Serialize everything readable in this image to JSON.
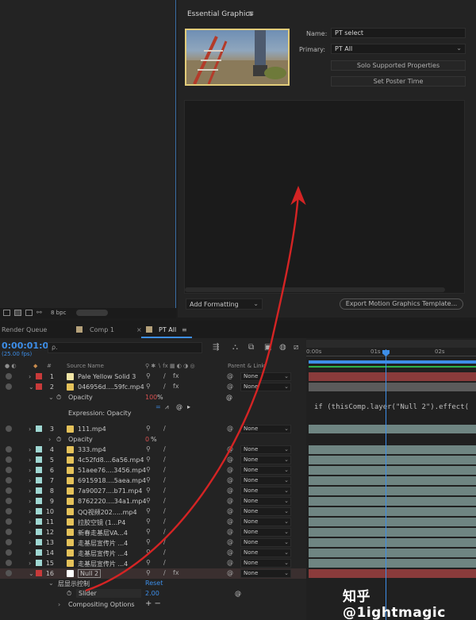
{
  "comp_panel": {
    "footer": {
      "bit_depth": "8 bpc"
    }
  },
  "eg": {
    "title": "Essential Graphics",
    "name_label": "Name:",
    "name_value": "PT select",
    "primary_label": "Primary:",
    "primary_value": "PT All",
    "solo_button": "Solo Supported Properties",
    "poster_button": "Set Poster Time",
    "add_formatting": "Add Formatting",
    "export_button": "Export Motion Graphics Template..."
  },
  "timeline": {
    "tabs": [
      {
        "label": "Render Queue"
      },
      {
        "label": "Comp 1"
      },
      {
        "label": "PT All"
      }
    ],
    "timecode": "0:00:01:04",
    "fps": "(25.00 fps)",
    "search_placeholder": "ρ.",
    "headers": {
      "hash": "#",
      "source_name": "Source Name",
      "parent": "Parent & Link"
    },
    "ruler": [
      "0:00s",
      "01s",
      "02s"
    ],
    "layers": [
      {
        "num": "1",
        "name": "Pale Yellow Solid 3",
        "parent": "None",
        "color": "#c83a3a",
        "icon": "#f2e6a6"
      },
      {
        "num": "2",
        "name": "046956d....59fc.mp4",
        "parent": "None",
        "color": "#c83a3a",
        "icon": "#e5c25a"
      },
      {
        "num": "3",
        "name": "111.mp4",
        "parent": "None",
        "color": "#9fd7d2",
        "icon": "#e5c25a"
      },
      {
        "num": "4",
        "name": "333.mp4",
        "parent": "None",
        "color": "#9fd7d2",
        "icon": "#e5c25a"
      },
      {
        "num": "5",
        "name": "4c52fd8....6a56.mp4",
        "parent": "None",
        "color": "#9fd7d2",
        "icon": "#e5c25a"
      },
      {
        "num": "6",
        "name": "51aee76....3456.mp4",
        "parent": "None",
        "color": "#9fd7d2",
        "icon": "#e5c25a"
      },
      {
        "num": "7",
        "name": "6915918....5aea.mp4",
        "parent": "None",
        "color": "#9fd7d2",
        "icon": "#e5c25a"
      },
      {
        "num": "8",
        "name": "7a90027....b71.mp4",
        "parent": "None",
        "color": "#9fd7d2",
        "icon": "#e5c25a"
      },
      {
        "num": "9",
        "name": "8762220....34a1.mp4",
        "parent": "None",
        "color": "#9fd7d2",
        "icon": "#e5c25a"
      },
      {
        "num": "10",
        "name": "QQ视频202.....mp4",
        "parent": "None",
        "color": "#9fd7d2",
        "icon": "#e5c25a"
      },
      {
        "num": "11",
        "name": "拉胶空镜 (1...P4",
        "parent": "None",
        "color": "#9fd7d2",
        "icon": "#e5c25a"
      },
      {
        "num": "12",
        "name": "新春走基层VA...4",
        "parent": "None",
        "color": "#9fd7d2",
        "icon": "#e5c25a"
      },
      {
        "num": "13",
        "name": "走基层宣传片 ...4",
        "parent": "None",
        "color": "#9fd7d2",
        "icon": "#e5c25a"
      },
      {
        "num": "14",
        "name": "走基层宣传片 ...4",
        "parent": "None",
        "color": "#9fd7d2",
        "icon": "#e5c25a"
      },
      {
        "num": "15",
        "name": "走基层宣传片 ...4",
        "parent": "None",
        "color": "#9fd7d2",
        "icon": "#e5c25a"
      },
      {
        "num": "16",
        "name": "Null 2",
        "parent": "None",
        "color": "#c83a3a",
        "icon": "#ffffff"
      }
    ],
    "opacity_label": "Opacity",
    "opacity_value_2": "100",
    "opacity_value_3": "0",
    "pct": "%",
    "expression_label": "Expression: Opacity",
    "expression_text": "if (thisComp.layer(\"Null 2\").effect(",
    "effect_group": "层显示控制",
    "reset": "Reset",
    "slider_label": "Slider",
    "slider_value": "2.00",
    "compositing": "Compositing Options"
  },
  "watermark": "知乎 @1ightmagic",
  "colors": {
    "accent": "#3d8ee8",
    "arrow": "#d42424",
    "label_red": "#c83a3a",
    "label_cyan": "#9fd7d2",
    "red_track": "#8a3b3b",
    "teal_track": "#6f8582"
  }
}
